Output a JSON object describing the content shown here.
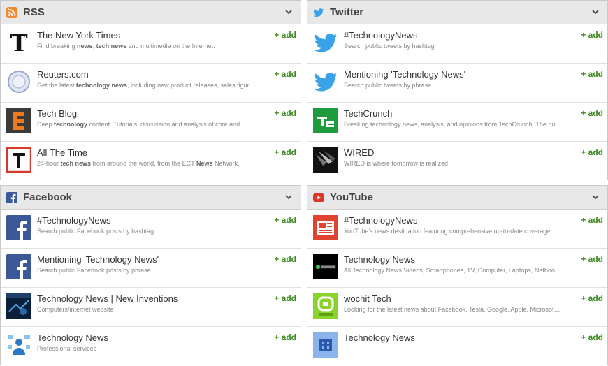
{
  "colors": {
    "add": "#3a8a1e",
    "rss": "#f0882e",
    "twitter": "#3aa2e8",
    "facebook": "#3b5998",
    "youtube": "#d9382a"
  },
  "add_label": "+ add",
  "panels": {
    "rss": {
      "title": "RSS",
      "items": [
        {
          "title": "The New York Times",
          "desc": [
            "Find breaking ",
            "news",
            ", ",
            "tech news",
            " and multimedia on the Internet."
          ]
        },
        {
          "title": "Reuters.com",
          "desc": [
            "Get the latest ",
            "technology news",
            ", including new product releases, sales figur…"
          ]
        },
        {
          "title": "Tech Blog",
          "desc": [
            "Deep ",
            "technology",
            " content. Tutorials, discussion and analysis of core and"
          ]
        },
        {
          "title": "All The Time",
          "desc": [
            "24-hour ",
            "tech news",
            " from around the world, from the ECT ",
            "News",
            " Network."
          ]
        }
      ]
    },
    "twitter": {
      "title": "Twitter",
      "items": [
        {
          "title": "#TechnologyNews",
          "desc": [
            "Search public tweets by hashtag"
          ]
        },
        {
          "title": "Mentioning 'Technology News'",
          "desc": [
            "Search public tweets by phrase"
          ]
        },
        {
          "title": "TechCrunch",
          "desc": [
            "Breaking technology news, analysis, and opinions from TechCrunch. The nu…"
          ]
        },
        {
          "title": "WIRED",
          "desc": [
            "WIRED is where tomorrow is realized."
          ]
        }
      ]
    },
    "facebook": {
      "title": "Facebook",
      "items": [
        {
          "title": "#TechnologyNews",
          "desc": [
            "Search public Facebook posts by hashtag"
          ]
        },
        {
          "title": "Mentioning 'Technology News'",
          "desc": [
            "Search public Facebook posts by phrase"
          ]
        },
        {
          "title": "Technology News | New Inventions",
          "desc": [
            "Computers/internet website"
          ]
        },
        {
          "title": "Technology News",
          "desc": [
            "Professional services"
          ]
        }
      ]
    },
    "youtube": {
      "title": "YouTube",
      "items": [
        {
          "title": "#TechnologyNews",
          "desc": [
            "YouTube's news destination featuring comprehensive up-to-date coverage …"
          ]
        },
        {
          "title": "Technology News",
          "desc": [
            "All Technology News Videos, Smartphones, TV, Computer, Laptops, Netboo…"
          ]
        },
        {
          "title": "wochit Tech",
          "desc": [
            "Looking for the latest news about Facebook, Tesla, Google, Apple, Microsof…"
          ]
        },
        {
          "title": "Technology News",
          "desc": []
        }
      ]
    }
  }
}
